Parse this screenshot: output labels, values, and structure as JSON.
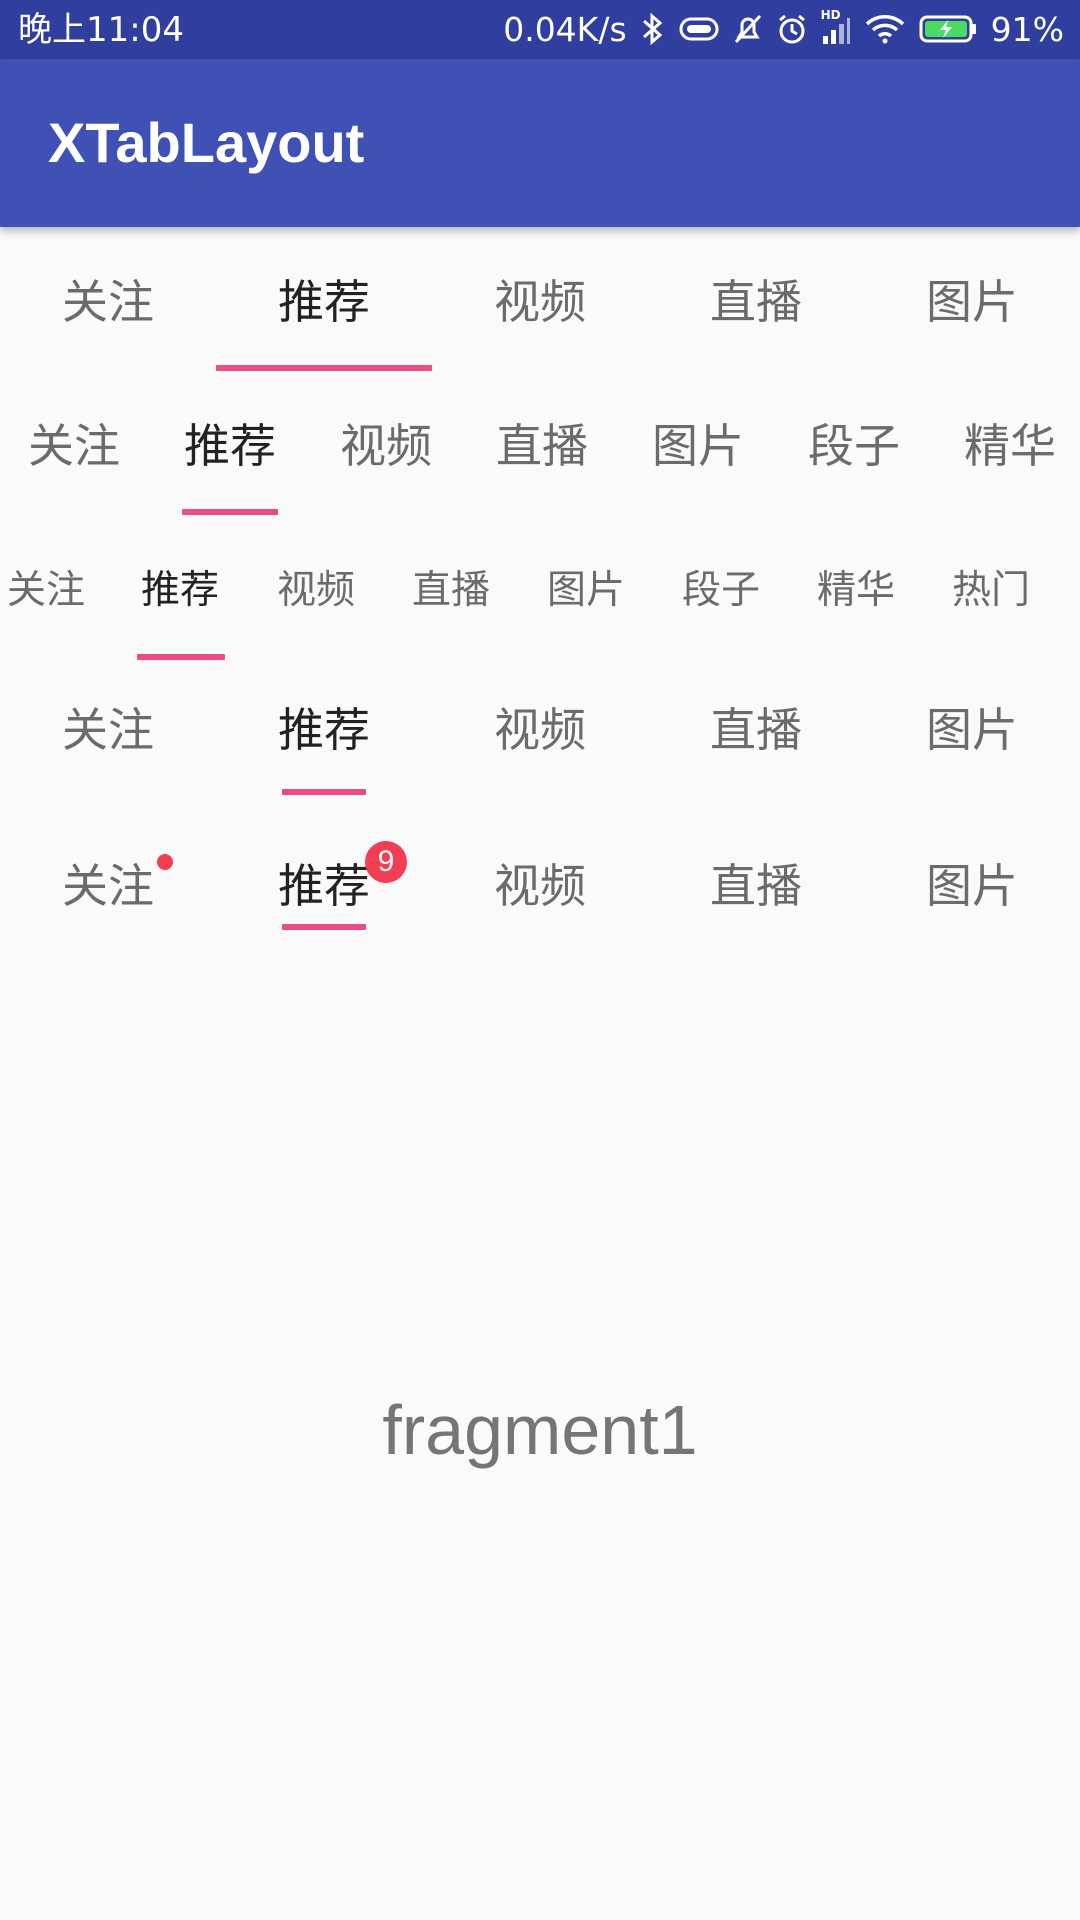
{
  "status_bar": {
    "time": "晚上11:04",
    "network_speed": "0.04K/s",
    "battery_percent": "91%",
    "icons": [
      "bluetooth-icon",
      "battery-saver-icon",
      "mute-icon",
      "alarm-icon",
      "signal-icon",
      "wifi-icon",
      "battery-icon"
    ],
    "hd_label": "HD"
  },
  "app_bar": {
    "title": "XTabLayout"
  },
  "tab_rows": [
    {
      "tabs": [
        "关注",
        "推荐",
        "视频",
        "直播",
        "图片"
      ],
      "selected_index": 1
    },
    {
      "tabs": [
        "关注",
        "推荐",
        "视频",
        "直播",
        "图片",
        "段子",
        "精华"
      ],
      "selected_index": 1
    },
    {
      "tabs": [
        "关注",
        "推荐",
        "视频",
        "直播",
        "图片",
        "段子",
        "精华",
        "热门"
      ],
      "selected_index": 1
    },
    {
      "tabs": [
        "关注",
        "推荐",
        "视频",
        "直播",
        "图片"
      ],
      "selected_index": 1
    },
    {
      "tabs": [
        "关注",
        "推荐",
        "视频",
        "直播",
        "图片"
      ],
      "selected_index": 1,
      "badge_count": "9"
    }
  ],
  "fragment": {
    "text": "fragment1"
  },
  "colors": {
    "status_bar": "#303f9f",
    "app_bar": "#3f51b5",
    "indicator": "#ea4c84",
    "badge": "#f33d52",
    "tab_selected": "#222222",
    "tab_unselected": "#6b6b6b"
  }
}
